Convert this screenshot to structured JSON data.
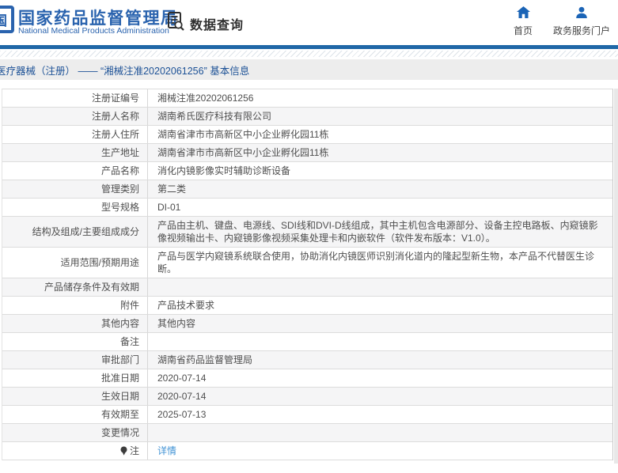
{
  "header": {
    "emblem_char": "国",
    "org_name": "国家药品监督管理局",
    "org_name_en": "National Medical Products Administration",
    "section_title": "数据查询",
    "nav": {
      "home_label": "首页",
      "portal_label": "政务服务门户"
    }
  },
  "breadcrumb": {
    "text": "医疗器械（注册） —— “湘械注准20202061256” 基本信息"
  },
  "table": {
    "rows": [
      {
        "label": "注册证编号",
        "value": "湘械注准20202061256"
      },
      {
        "label": "注册人名称",
        "value": "湖南希氏医疗科技有限公司"
      },
      {
        "label": "注册人住所",
        "value": "湖南省津市市高新区中小企业孵化园11栋"
      },
      {
        "label": "生产地址",
        "value": "湖南省津市市高新区中小企业孵化园11栋"
      },
      {
        "label": "产品名称",
        "value": "消化内镜影像实时辅助诊断设备"
      },
      {
        "label": "管理类别",
        "value": "第二类"
      },
      {
        "label": "型号规格",
        "value": "DI-01"
      },
      {
        "label": "结构及组成/主要组成成分",
        "value": "产品由主机、键盘、电源线、SDI线和DVI-D线组成，其中主机包含电源部分、设备主控电路板、内窥镜影像视频输出卡、内窥镜影像视频采集处理卡和内嵌软件（软件发布版本：V1.0）。"
      },
      {
        "label": "适用范围/预期用途",
        "value": "产品与医学内窥镜系统联合使用，协助消化内镜医师识别消化道内的隆起型新生物，本产品不代替医生诊断。"
      },
      {
        "label": "产品储存条件及有效期",
        "value": ""
      },
      {
        "label": "附件",
        "value": "产品技术要求"
      },
      {
        "label": "其他内容",
        "value": "其他内容"
      },
      {
        "label": "备注",
        "value": ""
      },
      {
        "label": "审批部门",
        "value": "湖南省药品监督管理局"
      },
      {
        "label": "批准日期",
        "value": "2020-07-14"
      },
      {
        "label": "生效日期",
        "value": "2020-07-14"
      },
      {
        "label": "有效期至",
        "value": "2025-07-13"
      },
      {
        "label": "变更情况",
        "value": ""
      },
      {
        "label": "注",
        "value": "详情",
        "link": true,
        "label_icon": "note-icon"
      }
    ]
  },
  "colors": {
    "brand_blue": "#2a63ae",
    "icon_blue": "#1b64b6",
    "bar_blue": "#1f67a7",
    "breadcrumb_bg": "#ededed",
    "breadcrumb_text": "#1c5196",
    "row_alt_bg": "#f5f5f6",
    "border_gray": "#dcdcdc",
    "text_gray": "#4f4f4f",
    "link_blue": "#4193d5"
  }
}
